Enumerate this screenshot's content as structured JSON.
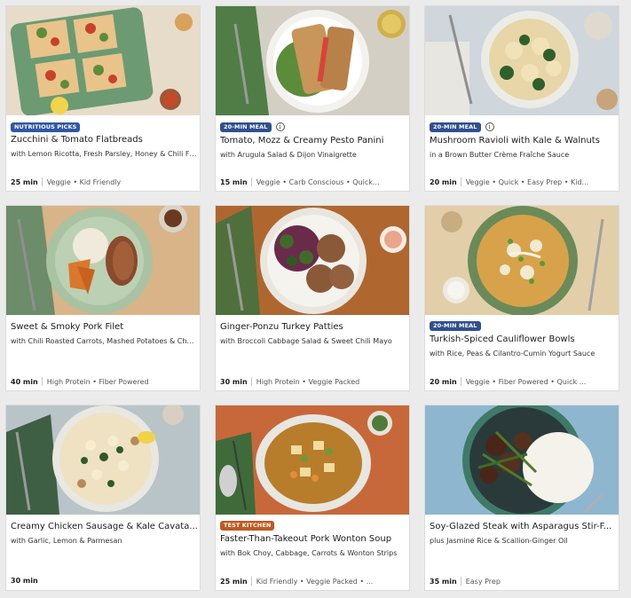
{
  "recipes": [
    {
      "badge": "NUTRITIOUS PICKS",
      "badge_type": "nutri",
      "info": false,
      "title": "Zucchini & Tomato Flatbreads",
      "subtitle": "with Lemon Ricotta, Fresh Parsley, Honey & Chili Fl...",
      "time": "25 min",
      "tags": "Veggie • Kid Friendly"
    },
    {
      "badge": "20-MIN MEAL",
      "badge_type": "20",
      "info": true,
      "title": "Tomato, Mozz & Creamy Pesto Panini",
      "subtitle": "with Arugula Salad & Dijon Vinaigrette",
      "time": "15 min",
      "tags": "Veggie • Carb Conscious • Quick..."
    },
    {
      "badge": "20-MIN MEAL",
      "badge_type": "20",
      "info": true,
      "title": "Mushroom Ravioli with Kale & Walnuts",
      "subtitle": "in a Brown Butter Crème Fraîche Sauce",
      "time": "20 min",
      "tags": "Veggie • Quick • Easy Prep • Kid..."
    },
    {
      "badge": "",
      "badge_type": "",
      "info": false,
      "title": "Sweet & Smoky Pork Filet",
      "subtitle": "with Chili Roasted Carrots, Mashed Potatoes & Cher...",
      "time": "40 min",
      "tags": "High Protein • Fiber Powered"
    },
    {
      "badge": "",
      "badge_type": "",
      "info": false,
      "title": "Ginger-Ponzu Turkey Patties",
      "subtitle": "with Broccoli Cabbage Salad & Sweet Chili Mayo",
      "time": "30 min",
      "tags": "High Protein • Veggie Packed"
    },
    {
      "badge": "20-MIN MEAL",
      "badge_type": "20",
      "info": true,
      "title": "Turkish-Spiced Cauliflower Bowls",
      "subtitle": "with Rice, Peas & Cilantro-Cumin Yogurt Sauce",
      "time": "20 min",
      "tags": "Veggie • Fiber Powered • Quick ..."
    },
    {
      "badge": "",
      "badge_type": "",
      "info": false,
      "title": "Creamy Chicken Sausage & Kale Cavata...",
      "subtitle": "with Garlic, Lemon & Parmesan",
      "time": "30 min",
      "tags": ""
    },
    {
      "badge": "TEST KITCHEN",
      "badge_type": "test",
      "info": false,
      "title": "Faster-Than-Takeout Pork Wonton Soup",
      "subtitle": "with Bok Choy, Cabbage, Carrots & Wonton Strips",
      "time": "25 min",
      "tags": "Kid Friendly • Veggie Packed • ..."
    },
    {
      "badge": "",
      "badge_type": "",
      "info": false,
      "title": "Soy-Glazed Steak with Asparagus Stir-F...",
      "subtitle": "plus Jasmine Rice & Scallion-Ginger Oil",
      "time": "35 min",
      "tags": "Easy Prep"
    }
  ],
  "info_icon_glyph": "i",
  "colors": {
    "badge_blue": "#2f57a5",
    "badge_navy": "#2f4f8f",
    "badge_orange": "#c05a1c",
    "background": "#ebebeb"
  }
}
